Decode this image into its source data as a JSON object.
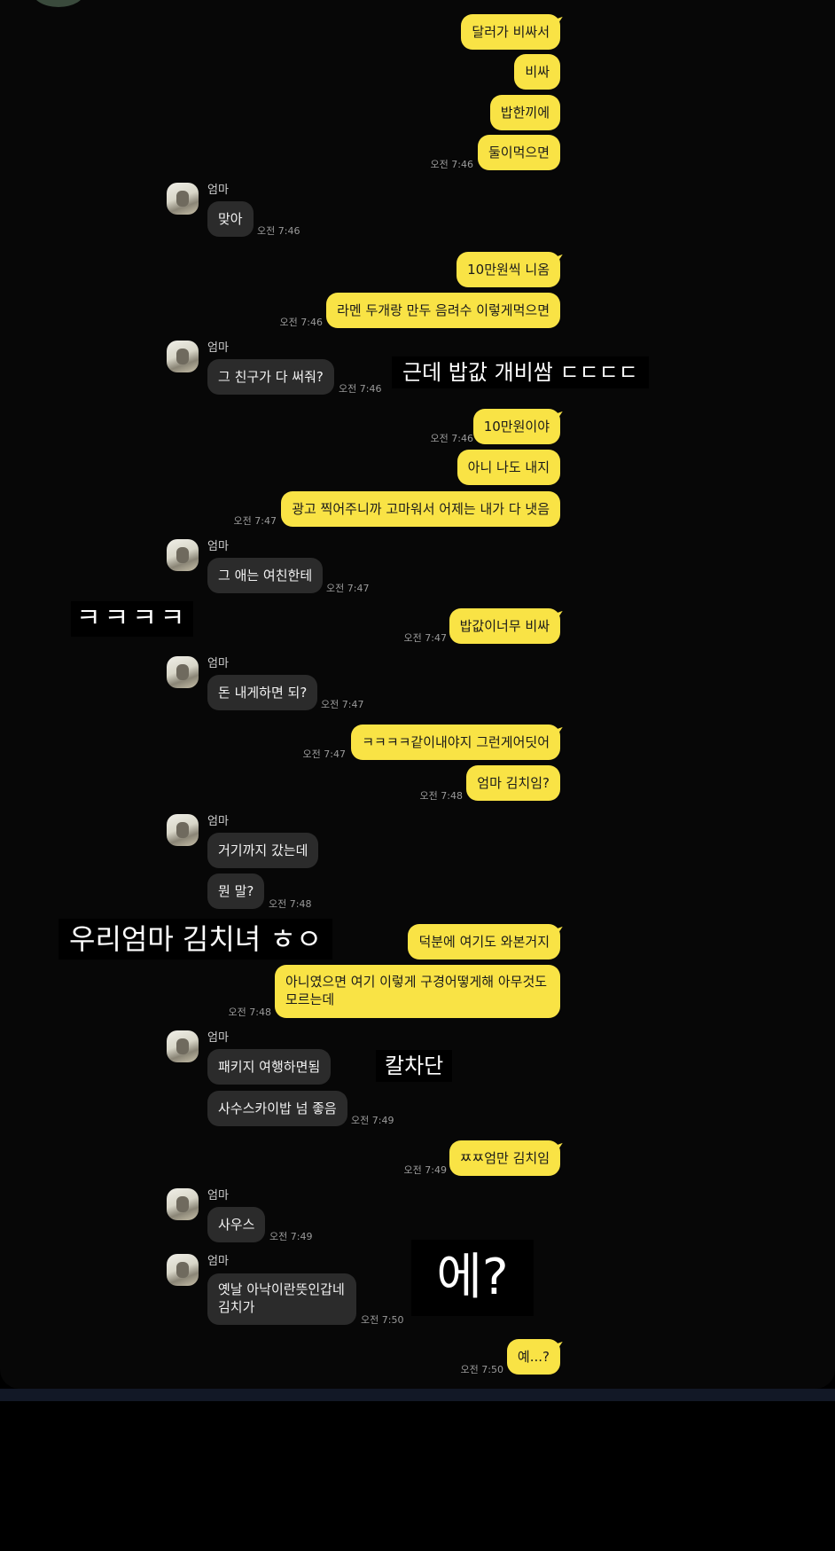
{
  "contact_name": "엄마",
  "messages": [
    {
      "side": "mine",
      "text": "달러가 비싸서"
    },
    {
      "side": "mine",
      "text": "비싸"
    },
    {
      "side": "mine",
      "text": "밥한끼에"
    },
    {
      "side": "mine",
      "text": "둘이먹으면",
      "time": "오전 7:46"
    },
    {
      "side": "theirs",
      "text": "맞아",
      "time": "오전 7:46"
    },
    {
      "side": "mine",
      "text": "10만원씩 니옴"
    },
    {
      "side": "mine",
      "text": "라멘 두개랑 만두 음려수 이렇게먹으면",
      "time": "오전 7:46"
    },
    {
      "side": "theirs",
      "text": "그 친구가 다 써줘?",
      "time": "오전 7:46"
    },
    {
      "side": "mine",
      "text": "10만원이야",
      "time": "오전 7:46"
    },
    {
      "side": "mine",
      "text": "아니 나도 내지"
    },
    {
      "side": "mine",
      "text": "광고 찍어주니까 고마워서 어제는 내가 다 냇음",
      "time": "오전 7:47"
    },
    {
      "side": "theirs",
      "text": "그 애는 여친한테",
      "time": "오전 7:47"
    },
    {
      "side": "mine",
      "text": "밥값이너무 비싸",
      "time": "오전 7:47"
    },
    {
      "side": "theirs",
      "text": "돈 내게하면 되?",
      "time": "오전 7:47"
    },
    {
      "side": "mine",
      "text": "ㅋㅋㅋㅋ같이내야지 그런게어딧어",
      "time": "오전 7:47"
    },
    {
      "side": "mine",
      "text": "엄마 김치임?",
      "time": "오전 7:48"
    },
    {
      "side": "theirs",
      "text": "거기까지 갔는데"
    },
    {
      "side": "theirs",
      "text": "뭔 말?",
      "time": "오전 7:48"
    },
    {
      "side": "mine",
      "text": "덕분에 여기도 와본거지"
    },
    {
      "side": "mine",
      "text": "아니였으면 여기 이렇게 구경어떻게해 아무것도 모르는데",
      "time": "오전 7:48"
    },
    {
      "side": "theirs",
      "text": "패키지 여행하면됨"
    },
    {
      "side": "theirs",
      "text": "사수스카이밥 넘 좋음",
      "time": "오전 7:49"
    },
    {
      "side": "mine",
      "text": "ㅉㅉ엄만 김치임",
      "time": "오전 7:49"
    },
    {
      "side": "theirs",
      "text": "사우스",
      "time": "오전 7:49"
    },
    {
      "side": "theirs",
      "text": "옛날 아낙이란뜻인갑네 김치가",
      "time": "오전 7:50"
    },
    {
      "side": "mine",
      "text": "예...?",
      "time": "오전 7:50"
    }
  ],
  "overlays": [
    "근데 밥값 개비쌈 ㄷㄷㄷㄷ",
    "ㅋㅋㅋㅋ",
    "우리엄마 김치녀 ㅎㅇ",
    "칼차단",
    "에?"
  ]
}
